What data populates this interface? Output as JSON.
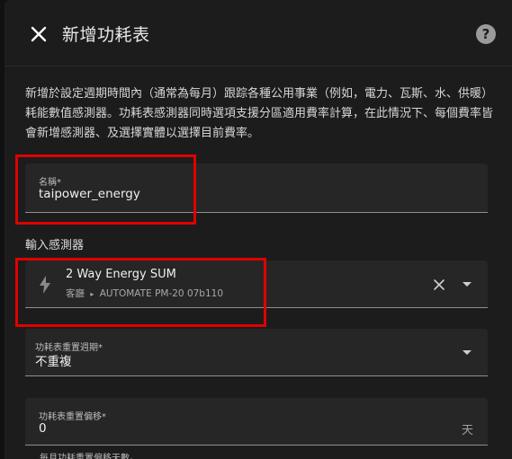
{
  "dialog": {
    "title": "新增功耗表",
    "description": "新增於設定週期時間內（通常為每月）跟踪各種公用事業（例如，電力、瓦斯、水、供暖）耗能數值感測器。功耗表感測器同時選項支援分區適用費率計算，在此情況下、每個費率皆會新增感測器、及選擇實體以選擇目前費率。"
  },
  "name_field": {
    "label": "名稱*",
    "value": "taipower_energy"
  },
  "input_sensor": {
    "section_label": "輸入感測器",
    "entity_name": "2 Way Energy SUM",
    "area": "客廳",
    "device": "AUTOMATE PM-20 07b110",
    "icon": "lightning-bolt-icon"
  },
  "cycle_field": {
    "label": "功耗表重置週期*",
    "value": "不重複"
  },
  "offset_field": {
    "label": "功耗表重置偏移*",
    "value": "0",
    "suffix": "天"
  },
  "next_field": {
    "label": "每月功耗重置偏移天數。"
  },
  "colors": {
    "background": "#111111",
    "surface": "#1c1c1c",
    "field": "#262626",
    "highlight": "#e00000"
  }
}
